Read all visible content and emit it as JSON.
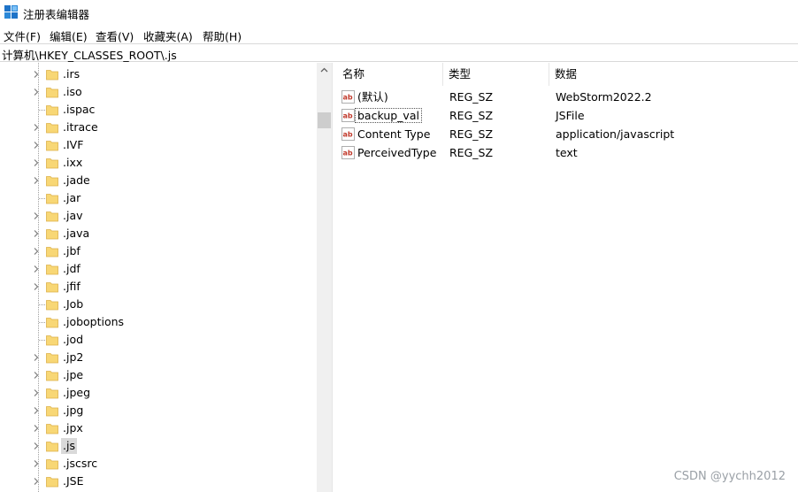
{
  "window": {
    "title": "注册表编辑器",
    "icon": "registry-editor-icon"
  },
  "menu": [
    "文件(F)",
    "编辑(E)",
    "查看(V)",
    "收藏夹(A)",
    "帮助(H)"
  ],
  "address": "计算机\\HKEY_CLASSES_ROOT\\.js",
  "tree": {
    "items": [
      {
        "label": ".irs",
        "has_children": true,
        "selected": false
      },
      {
        "label": ".iso",
        "has_children": true,
        "selected": false
      },
      {
        "label": ".ispac",
        "has_children": false,
        "selected": false
      },
      {
        "label": ".itrace",
        "has_children": true,
        "selected": false
      },
      {
        "label": ".IVF",
        "has_children": true,
        "selected": false
      },
      {
        "label": ".ixx",
        "has_children": true,
        "selected": false
      },
      {
        "label": ".jade",
        "has_children": true,
        "selected": false
      },
      {
        "label": ".jar",
        "has_children": false,
        "selected": false
      },
      {
        "label": ".jav",
        "has_children": true,
        "selected": false
      },
      {
        "label": ".java",
        "has_children": true,
        "selected": false
      },
      {
        "label": ".jbf",
        "has_children": true,
        "selected": false
      },
      {
        "label": ".jdf",
        "has_children": true,
        "selected": false
      },
      {
        "label": ".jfif",
        "has_children": true,
        "selected": false
      },
      {
        "label": ".Job",
        "has_children": false,
        "selected": false
      },
      {
        "label": ".joboptions",
        "has_children": false,
        "selected": false
      },
      {
        "label": ".jod",
        "has_children": false,
        "selected": false
      },
      {
        "label": ".jp2",
        "has_children": true,
        "selected": false
      },
      {
        "label": ".jpe",
        "has_children": true,
        "selected": false
      },
      {
        "label": ".jpeg",
        "has_children": true,
        "selected": false
      },
      {
        "label": ".jpg",
        "has_children": true,
        "selected": false
      },
      {
        "label": ".jpx",
        "has_children": true,
        "selected": false
      },
      {
        "label": ".js",
        "has_children": true,
        "selected": true
      },
      {
        "label": ".jscsrc",
        "has_children": true,
        "selected": false
      },
      {
        "label": ".JSE",
        "has_children": true,
        "selected": false
      }
    ]
  },
  "list": {
    "columns": [
      "名称",
      "类型",
      "数据"
    ],
    "rows": [
      {
        "name": "(默认)",
        "type": "REG_SZ",
        "data": "WebStorm2022.2",
        "icon": "string-value-icon",
        "focused": false
      },
      {
        "name": "backup_val",
        "type": "REG_SZ",
        "data": "JSFile",
        "icon": "string-value-icon",
        "focused": true
      },
      {
        "name": "Content Type",
        "type": "REG_SZ",
        "data": "application/javascript",
        "icon": "string-value-icon",
        "focused": false
      },
      {
        "name": "PerceivedType",
        "type": "REG_SZ",
        "data": "text",
        "icon": "string-value-icon",
        "focused": false
      }
    ]
  },
  "watermark": "CSDN @yychh2012",
  "colors": {
    "folder": "#f8d775",
    "folder_edge": "#dcb14a",
    "selection": "#d9d9d9",
    "ab_red": "#c0392b"
  }
}
